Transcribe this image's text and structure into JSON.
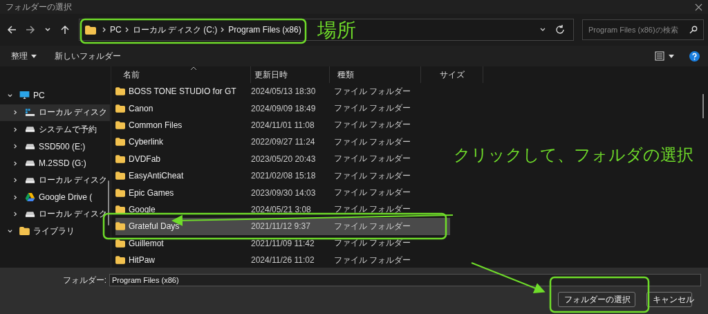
{
  "window": {
    "title": "フォルダーの選択"
  },
  "address_bar": {
    "crumbs": [
      "PC",
      "ローカル ディスク (C:)",
      "Program Files (x86)"
    ]
  },
  "search": {
    "placeholder": "Program Files (x86)の検索"
  },
  "toolbar": {
    "organize": "整理",
    "new_folder": "新しいフォルダー"
  },
  "sidebar": {
    "items": [
      {
        "label": "PC",
        "kind": "pc",
        "expanded": true,
        "selected": false,
        "children": [
          {
            "label": "ローカル ディスク",
            "kind": "sysdrive",
            "expanded": false,
            "selected": true
          },
          {
            "label": "システムで予約",
            "kind": "drive",
            "expanded": false,
            "selected": false
          },
          {
            "label": "SSD500 (E:)",
            "kind": "drive",
            "expanded": false,
            "selected": false
          },
          {
            "label": "M.2SSD (G:)",
            "kind": "drive",
            "expanded": false,
            "selected": false
          },
          {
            "label": "ローカル ディスク",
            "kind": "drive",
            "expanded": false,
            "selected": false
          },
          {
            "label": "Google Drive (",
            "kind": "gdrive",
            "expanded": false,
            "selected": false
          },
          {
            "label": "ローカル ディスク",
            "kind": "drive",
            "expanded": false,
            "selected": false
          }
        ]
      },
      {
        "label": "ライブラリ",
        "kind": "folder",
        "expanded": true,
        "selected": false
      }
    ]
  },
  "table": {
    "columns": [
      "名前",
      "更新日時",
      "種類",
      "サイズ"
    ],
    "rows": [
      {
        "name": "BOSS TONE STUDIO for GT",
        "date": "2024/05/13 18:30",
        "type": "ファイル フォルダー",
        "selected": false
      },
      {
        "name": "Canon",
        "date": "2024/09/09 18:49",
        "type": "ファイル フォルダー",
        "selected": false
      },
      {
        "name": "Common Files",
        "date": "2024/11/01 11:08",
        "type": "ファイル フォルダー",
        "selected": false
      },
      {
        "name": "Cyberlink",
        "date": "2022/09/27 11:24",
        "type": "ファイル フォルダー",
        "selected": false
      },
      {
        "name": "DVDFab",
        "date": "2023/05/20 20:43",
        "type": "ファイル フォルダー",
        "selected": false
      },
      {
        "name": "EasyAntiCheat",
        "date": "2021/02/08 15:18",
        "type": "ファイル フォルダー",
        "selected": false
      },
      {
        "name": "Epic Games",
        "date": "2023/09/30 14:03",
        "type": "ファイル フォルダー",
        "selected": false
      },
      {
        "name": "Google",
        "date": "2024/05/21 3:08",
        "type": "ファイル フォルダー",
        "selected": false
      },
      {
        "name": "Grateful Days",
        "date": "2021/11/12 9:37",
        "type": "ファイル フォルダー",
        "selected": true
      },
      {
        "name": "Guillemot",
        "date": "2021/11/09 11:42",
        "type": "ファイル フォルダー",
        "selected": false
      },
      {
        "name": "HitPaw",
        "date": "2024/11/26 11:02",
        "type": "ファイル フォルダー",
        "selected": false
      }
    ]
  },
  "footer": {
    "label": "フォルダー:",
    "value": "Program Files (x86)",
    "buttons": [
      "フォルダーの選択",
      "キャンセル"
    ]
  },
  "annotations": {
    "location_label": "場所",
    "click_label": "クリックして、フォルダの選択"
  }
}
